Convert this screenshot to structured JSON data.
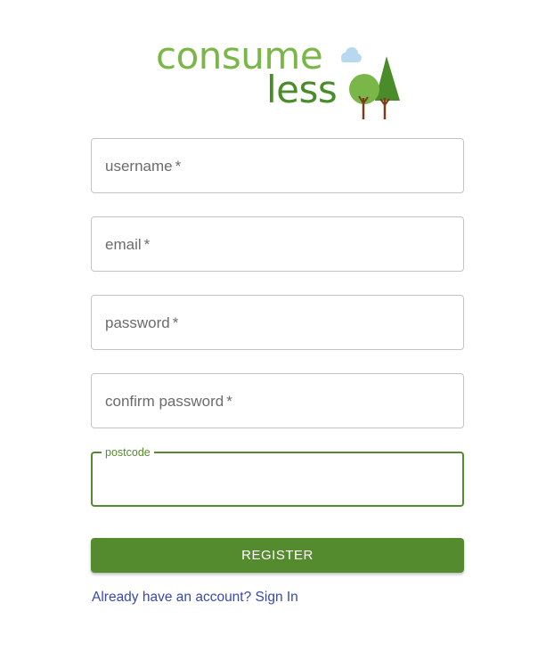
{
  "logo": {
    "line1": "consume",
    "line2": "less",
    "colors": {
      "light_green": "#7ab648",
      "dark_green": "#4a8c2a",
      "cloud": "#b8d8ef",
      "trunk": "#7a3e1e"
    }
  },
  "form": {
    "fields": [
      {
        "label": "username",
        "required_mark": "*"
      },
      {
        "label": "email",
        "required_mark": "*"
      },
      {
        "label": "password",
        "required_mark": "*"
      },
      {
        "label": "confirm password",
        "required_mark": "*"
      },
      {
        "label": "postcode",
        "value": "",
        "focused": true
      }
    ],
    "submit_label": "REGISTER",
    "signin_link": "Already have an account? Sign In"
  },
  "colors": {
    "primary": "#558b2f",
    "link": "#3949ab",
    "border": "#c4c4c4"
  }
}
